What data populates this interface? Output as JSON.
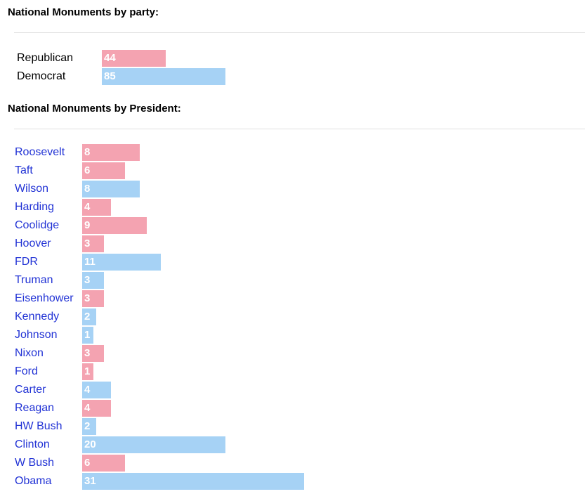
{
  "colors": {
    "Republican": "#f4a3b1",
    "Democrat": "#a6d2f5",
    "link": "#2233d5"
  },
  "party_section": {
    "title": "National Monuments by party:"
  },
  "president_section": {
    "title": "National Monuments by President:"
  },
  "chart_data": [
    {
      "type": "bar",
      "orientation": "horizontal",
      "title": "National Monuments by party:",
      "categories": [
        "Republican",
        "Democrat"
      ],
      "values": [
        44,
        85
      ],
      "party": [
        "Republican",
        "Democrat"
      ]
    },
    {
      "type": "bar",
      "orientation": "horizontal",
      "title": "National Monuments by President:",
      "categories": [
        "Roosevelt",
        "Taft",
        "Wilson",
        "Harding",
        "Coolidge",
        "Hoover",
        "FDR",
        "Truman",
        "Eisenhower",
        "Kennedy",
        "Johnson",
        "Nixon",
        "Ford",
        "Carter",
        "Reagan",
        "HW Bush",
        "Clinton",
        "W Bush",
        "Obama"
      ],
      "values": [
        8,
        6,
        8,
        4,
        9,
        3,
        11,
        3,
        3,
        2,
        1,
        3,
        1,
        4,
        4,
        2,
        20,
        6,
        31
      ],
      "party": [
        "Republican",
        "Republican",
        "Democrat",
        "Republican",
        "Republican",
        "Republican",
        "Democrat",
        "Democrat",
        "Republican",
        "Democrat",
        "Democrat",
        "Republican",
        "Republican",
        "Democrat",
        "Republican",
        "Democrat",
        "Democrat",
        "Republican",
        "Democrat"
      ]
    }
  ]
}
